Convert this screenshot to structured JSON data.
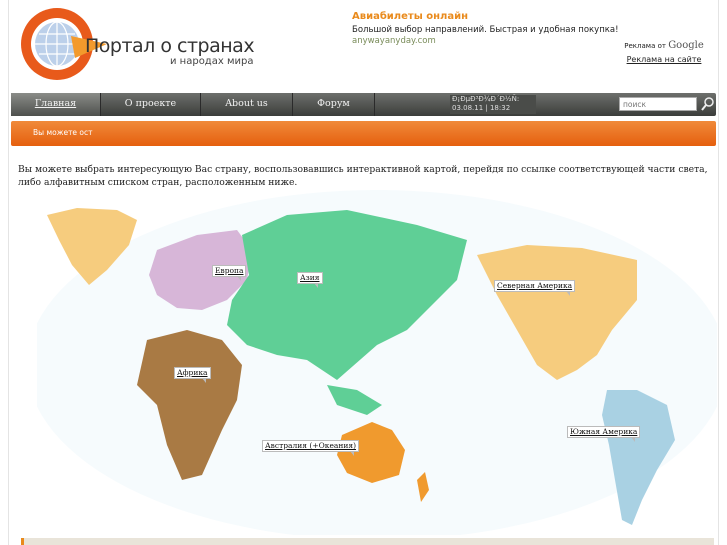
{
  "header": {
    "logo_title": "Портал о странах",
    "logo_subtitle": "и народах мира"
  },
  "ad": {
    "title": "Авиабилеты онлайн",
    "text": "Большой выбор направлений. Быстрая и удобная покупка!",
    "url": "anywayanyday.com"
  },
  "google_ad": {
    "prefix": "Реклама от",
    "brand": "Google",
    "link": "Реклама на сайте"
  },
  "nav": {
    "items": [
      {
        "label": "Главная"
      },
      {
        "label": "О проекте"
      },
      {
        "label": "About us"
      },
      {
        "label": "Форум"
      }
    ],
    "date_line1": "Ð¡ÐµÐ³Ð¾Ð´Ð½Ñ:",
    "date_line2": "03.08.11 | 18:32",
    "search_placeholder": "поиск"
  },
  "breadcrumb": "Вы можете ост",
  "intro": "Вы можете выбрать интересующую Вас страну, воспользовавшись интерактивной картой, перейдя по ссылке соответствующей части света, либо алфавитным списком стран, расположенным ниже.",
  "map": {
    "colors": {
      "europe": "#d7b6d8",
      "asia": "#5fcf96",
      "africa": "#a97a44",
      "north_america": "#f6cc7e",
      "south_america": "#a9d1e3",
      "australia": "#f09a2e",
      "ocean": "#f6fbfd"
    },
    "labels": {
      "europe": "Европа",
      "asia": "Азия",
      "africa": "Африка",
      "north_america": "Северная Америка",
      "south_america": "Южная Америка",
      "australia": "Австралия (+Океания)"
    }
  }
}
